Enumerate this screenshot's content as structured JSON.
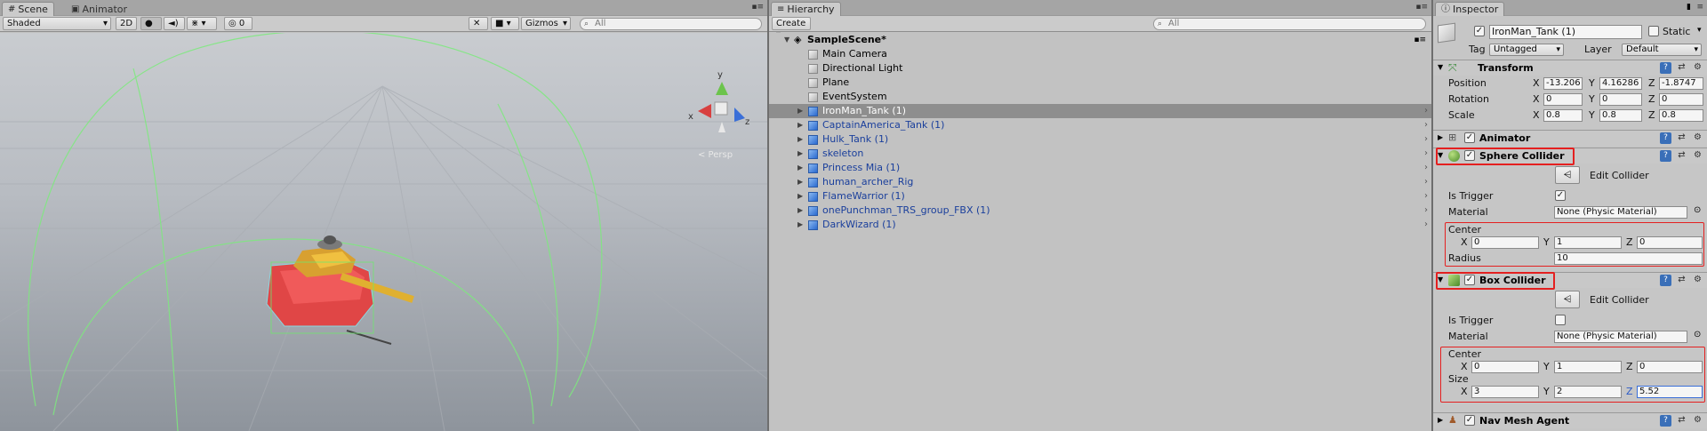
{
  "scene_panel": {
    "tabs": [
      {
        "label": "Scene"
      },
      {
        "label": "Animator"
      }
    ],
    "toolbar": {
      "shading_mode": "Shaded",
      "mode_2d": "2D",
      "hidden_count": "0",
      "gizmos": "Gizmos",
      "search_placeholder": "All"
    },
    "gizmo_labels": {
      "y": "y",
      "x": "x",
      "z": "z",
      "persp": "< Persp"
    }
  },
  "hierarchy_panel": {
    "tab_label": "Hierarchy",
    "create_label": "Create",
    "search_placeholder": "All",
    "scene_name": "SampleScene*",
    "items": [
      {
        "label": "Main Camera",
        "prefab": false,
        "expandable": false,
        "selected": false
      },
      {
        "label": "Directional Light",
        "prefab": false,
        "expandable": false,
        "selected": false
      },
      {
        "label": "Plane",
        "prefab": false,
        "expandable": false,
        "selected": false
      },
      {
        "label": "EventSystem",
        "prefab": false,
        "expandable": false,
        "selected": false
      },
      {
        "label": "IronMan_Tank (1)",
        "prefab": true,
        "expandable": true,
        "selected": true
      },
      {
        "label": "CaptainAmerica_Tank (1)",
        "prefab": true,
        "expandable": true,
        "selected": false
      },
      {
        "label": "Hulk_Tank (1)",
        "prefab": true,
        "expandable": true,
        "selected": false
      },
      {
        "label": "skeleton",
        "prefab": true,
        "expandable": true,
        "selected": false
      },
      {
        "label": "Princess Mia (1)",
        "prefab": true,
        "expandable": true,
        "selected": false
      },
      {
        "label": "human_archer_Rig",
        "prefab": true,
        "expandable": true,
        "selected": false
      },
      {
        "label": "FlameWarrior (1)",
        "prefab": true,
        "expandable": true,
        "selected": false
      },
      {
        "label": "onePunchman_TRS_group_FBX (1)",
        "prefab": true,
        "expandable": true,
        "selected": false
      },
      {
        "label": "DarkWizard (1)",
        "prefab": true,
        "expandable": true,
        "selected": false
      }
    ]
  },
  "inspector": {
    "tab_label": "Inspector",
    "object_name": "IronMan_Tank (1)",
    "static_label": "Static",
    "tag_label": "Tag",
    "tag_value": "Untagged",
    "layer_label": "Layer",
    "layer_value": "Default",
    "transform": {
      "title": "Transform",
      "position_label": "Position",
      "rotation_label": "Rotation",
      "scale_label": "Scale",
      "position": {
        "x": "-13.206",
        "y": "4.16286",
        "z": "-1.8747"
      },
      "rotation": {
        "x": "0",
        "y": "0",
        "z": "0"
      },
      "scale": {
        "x": "0.8",
        "y": "0.8",
        "z": "0.8"
      }
    },
    "animator": {
      "title": "Animator"
    },
    "sphere_collider": {
      "title": "Sphere Collider",
      "edit_collider_label": "Edit Collider",
      "is_trigger_label": "Is Trigger",
      "is_trigger": true,
      "material_label": "Material",
      "material_value": "None (Physic Material)",
      "center_label": "Center",
      "center": {
        "x": "0",
        "y": "1",
        "z": "0"
      },
      "radius_label": "Radius",
      "radius": "10"
    },
    "box_collider": {
      "title": "Box Collider",
      "edit_collider_label": "Edit Collider",
      "is_trigger_label": "Is Trigger",
      "is_trigger": false,
      "material_label": "Material",
      "material_value": "None (Physic Material)",
      "center_label": "Center",
      "center": {
        "x": "0",
        "y": "1",
        "z": "0"
      },
      "size_label": "Size",
      "size": {
        "x": "3",
        "y": "2",
        "z": "5.52"
      }
    },
    "nav_mesh_agent": {
      "title": "Nav Mesh Agent"
    },
    "axis_labels": {
      "x": "X",
      "y": "Y",
      "z": "Z"
    }
  },
  "colors": {
    "highlight_red": "#e42020",
    "prefab_blue": "#1a3f9c",
    "selection_gray": "#8e8e8e"
  }
}
